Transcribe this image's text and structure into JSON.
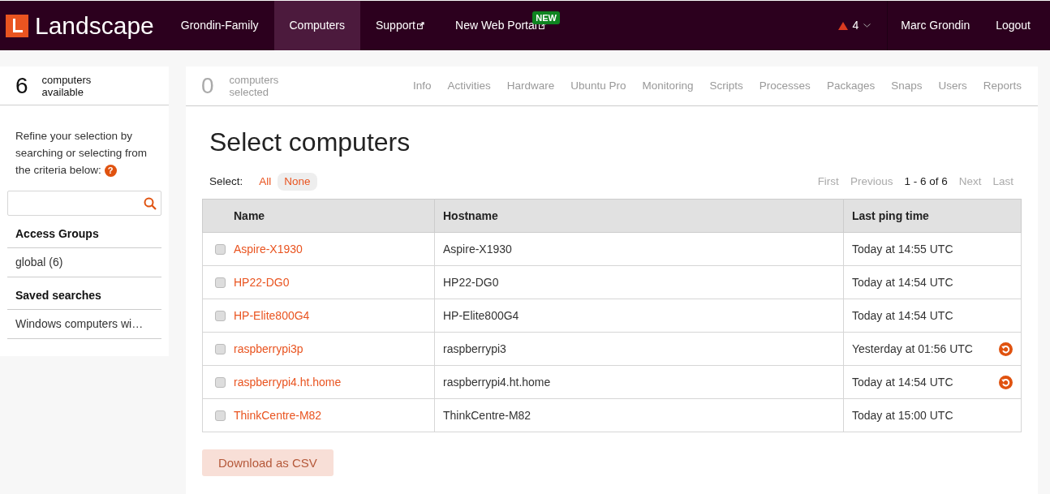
{
  "nav": {
    "logo": "Landscape",
    "items": [
      {
        "label": "Grondin-Family",
        "selected": false,
        "external": false
      },
      {
        "label": "Computers",
        "selected": true,
        "external": false
      },
      {
        "label": "Support",
        "selected": false,
        "external": true
      },
      {
        "label": "New Web Portal",
        "selected": false,
        "external": true,
        "badge": "NEW"
      }
    ],
    "alerts": "4",
    "user": "Marc Grondin",
    "logout": "Logout"
  },
  "sidebar": {
    "count": "6",
    "count_label": "computers available",
    "intro": "Refine your selection by searching or selecting from the criteria below:",
    "help": "?",
    "sections": [
      {
        "title": "Access Groups",
        "items": [
          "global (6)"
        ]
      },
      {
        "title": "Saved searches",
        "items": [
          "Windows computers wi…"
        ]
      }
    ]
  },
  "main": {
    "count": "0",
    "count_label": "computers selected",
    "tabs": [
      "Info",
      "Activities",
      "Hardware",
      "Ubuntu Pro",
      "Monitoring",
      "Scripts",
      "Processes",
      "Packages",
      "Snaps",
      "Users",
      "Reports"
    ],
    "title": "Select computers",
    "select_label": "Select:",
    "select_options": [
      {
        "label": "All",
        "selected": false
      },
      {
        "label": "None",
        "selected": true
      }
    ],
    "pager": [
      {
        "label": "First",
        "disabled": true
      },
      {
        "label": "Previous",
        "disabled": true
      },
      {
        "label": "1 - 6 of 6",
        "disabled": false
      },
      {
        "label": "Next",
        "disabled": true
      },
      {
        "label": "Last",
        "disabled": true
      }
    ],
    "columns": [
      "Name",
      "Hostname",
      "Last ping time"
    ],
    "rows": [
      {
        "name": "Aspire-X1930",
        "hostname": "Aspire-X1930",
        "ping": "Today at 14:55 UTC",
        "checked": false,
        "reboot": false
      },
      {
        "name": "HP22-DG0",
        "hostname": "HP22-DG0",
        "ping": "Today at 14:54 UTC",
        "checked": false,
        "reboot": false
      },
      {
        "name": "HP-Elite800G4",
        "hostname": "HP-Elite800G4",
        "ping": "Today at 14:54 UTC",
        "checked": false,
        "reboot": false
      },
      {
        "name": "raspberrypi3p",
        "hostname": "raspberrypi3",
        "ping": "Yesterday at 01:56 UTC",
        "checked": false,
        "reboot": true
      },
      {
        "name": "raspberrypi4.ht.home",
        "hostname": "raspberrypi4.ht.home",
        "ping": "Today at 14:54 UTC",
        "checked": false,
        "reboot": true
      },
      {
        "name": "ThinkCentre-M82",
        "hostname": "ThinkCentre-M82",
        "ping": "Today at 15:00 UTC",
        "checked": false,
        "reboot": false
      }
    ],
    "download": {
      "label": "Download as CSV",
      "disabled": true
    }
  }
}
